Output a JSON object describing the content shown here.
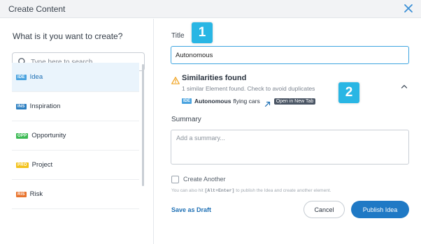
{
  "header": {
    "title": "Create Content",
    "close_icon": "close-icon"
  },
  "left_panel": {
    "question": "What is it you want to create?",
    "search": {
      "placeholder": "Type here to search",
      "value": "",
      "icon": "search-icon"
    },
    "items": [
      {
        "badge": "IDE",
        "label": "Idea",
        "badge_color": "#4aa3df",
        "selected": true
      },
      {
        "badge": "INS",
        "label": "Inspiration",
        "badge_color": "#2d7fc1",
        "selected": false
      },
      {
        "badge": "OPP",
        "label": "Opportunity",
        "badge_color": "#3cba54",
        "selected": false
      },
      {
        "badge": "PRO",
        "label": "Project",
        "badge_color": "#f3c21b",
        "selected": false
      },
      {
        "badge": "RIS",
        "label": "Risk",
        "badge_color": "#e8732c",
        "selected": false
      }
    ]
  },
  "form": {
    "title_label": "Title",
    "title_value": "Autonomous",
    "similarities": {
      "title": "Similarities found",
      "subtitle": "1 similar Element found. Check to avoid duplicates",
      "result_badge": "IDE",
      "result_bold": "Autonomous",
      "result_rest": "flying cars",
      "open_tooltip": "Open in New Tab",
      "icons": [
        "warning-icon",
        "chevron-up-icon",
        "external-link-icon"
      ]
    },
    "summary_label": "Summary",
    "summary_placeholder": "Add a summary...",
    "create_another_label": "Create Another",
    "hint_pre": "You can also hit",
    "hint_key": "[Alt+Enter]",
    "hint_post": "to publish the Idea and create another element.",
    "save_draft_label": "Save as Draft",
    "cancel_label": "Cancel",
    "publish_label": "Publish Idea"
  },
  "callouts": [
    "1",
    "2"
  ],
  "colors": {
    "accent": "#1f79c5",
    "focus_border": "#3fa5e0",
    "callout": "#29b6e4",
    "warning": "#f0a21f",
    "selected_bg": "#eaf4fc"
  }
}
